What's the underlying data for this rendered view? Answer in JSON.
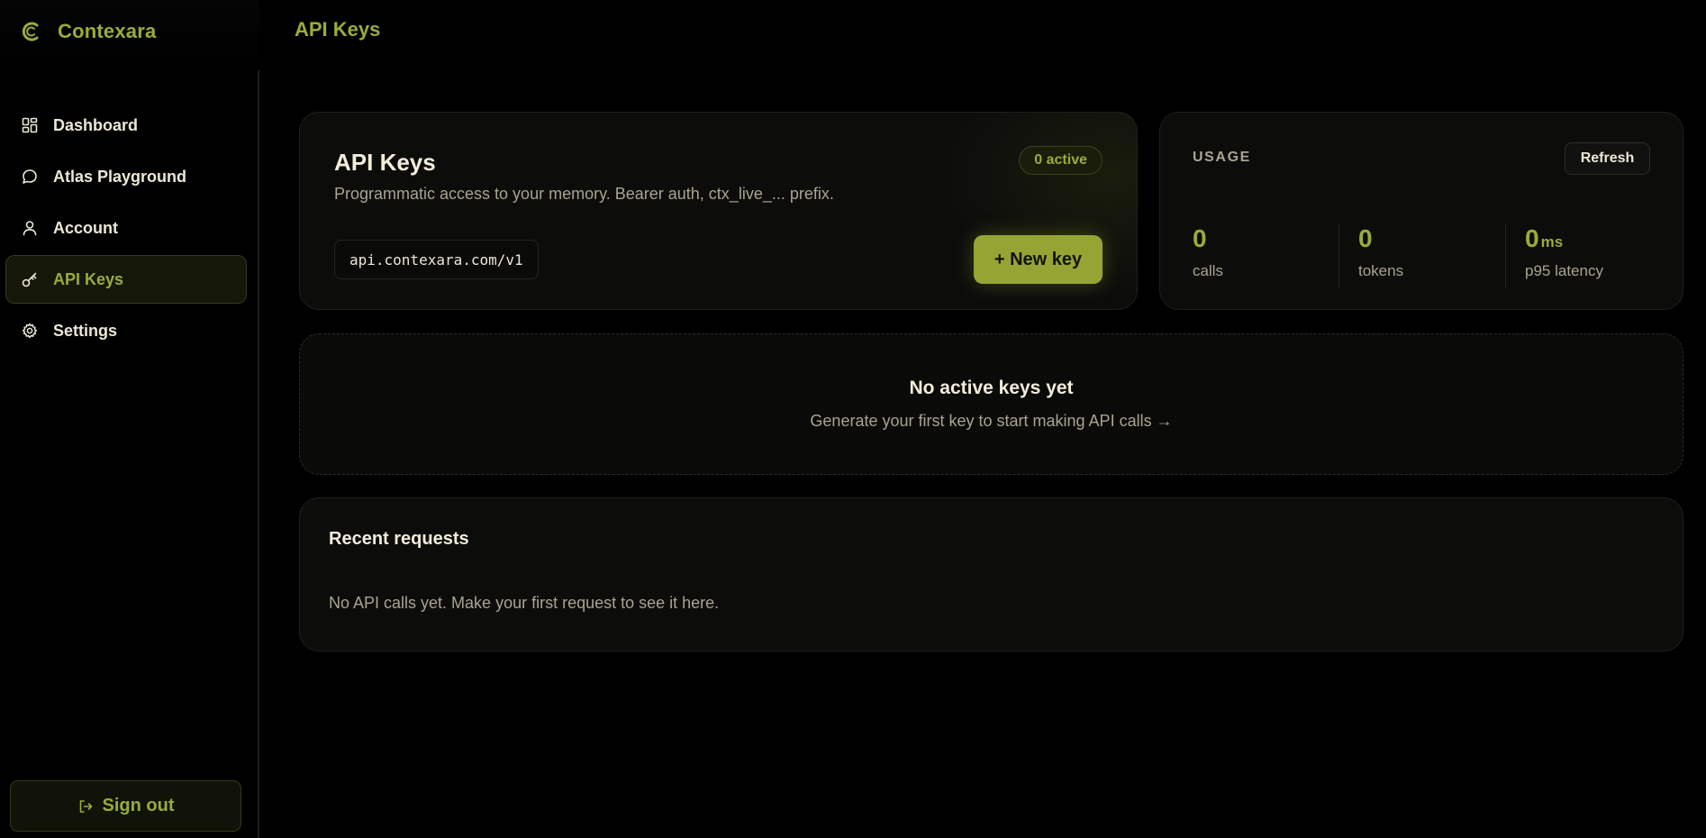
{
  "brand": {
    "name": "Contexara",
    "icon": "contexara-logo-icon"
  },
  "header": {
    "title": "API Keys"
  },
  "sidebar": {
    "items": [
      {
        "label": "Dashboard",
        "icon": "grid-icon",
        "active": false
      },
      {
        "label": "Atlas Playground",
        "icon": "chat-bubble-icon",
        "active": false
      },
      {
        "label": "Account",
        "icon": "user-icon",
        "active": false
      },
      {
        "label": "API Keys",
        "icon": "key-icon",
        "active": true
      },
      {
        "label": "Settings",
        "icon": "gear-icon",
        "active": false
      }
    ],
    "signout_label": "Sign out"
  },
  "keys_card": {
    "title": "API Keys",
    "subtitle": "Programmatic access to your memory. Bearer auth, ctx_live_... prefix.",
    "badge": "0 active",
    "endpoint": "api.contexara.com/v1",
    "new_key_label": "+ New key"
  },
  "usage": {
    "title": "USAGE",
    "refresh_label": "Refresh",
    "stats": [
      {
        "value": "0",
        "unit": "",
        "label": "calls"
      },
      {
        "value": "0",
        "unit": "",
        "label": "tokens"
      },
      {
        "value": "0",
        "unit": "ms",
        "label": "p95 latency"
      }
    ]
  },
  "empty_state": {
    "title": "No active keys yet",
    "subtitle": "Generate your first key to start making API calls →"
  },
  "recent": {
    "title": "Recent requests",
    "empty_text": "No API calls yet. Make your first request to see it here."
  },
  "colors": {
    "accent": "#9aac3a",
    "button": "#95a534",
    "background": "#000000",
    "card": "#0c0c0b",
    "text": "#ece7d6",
    "muted": "#a9a48f"
  }
}
